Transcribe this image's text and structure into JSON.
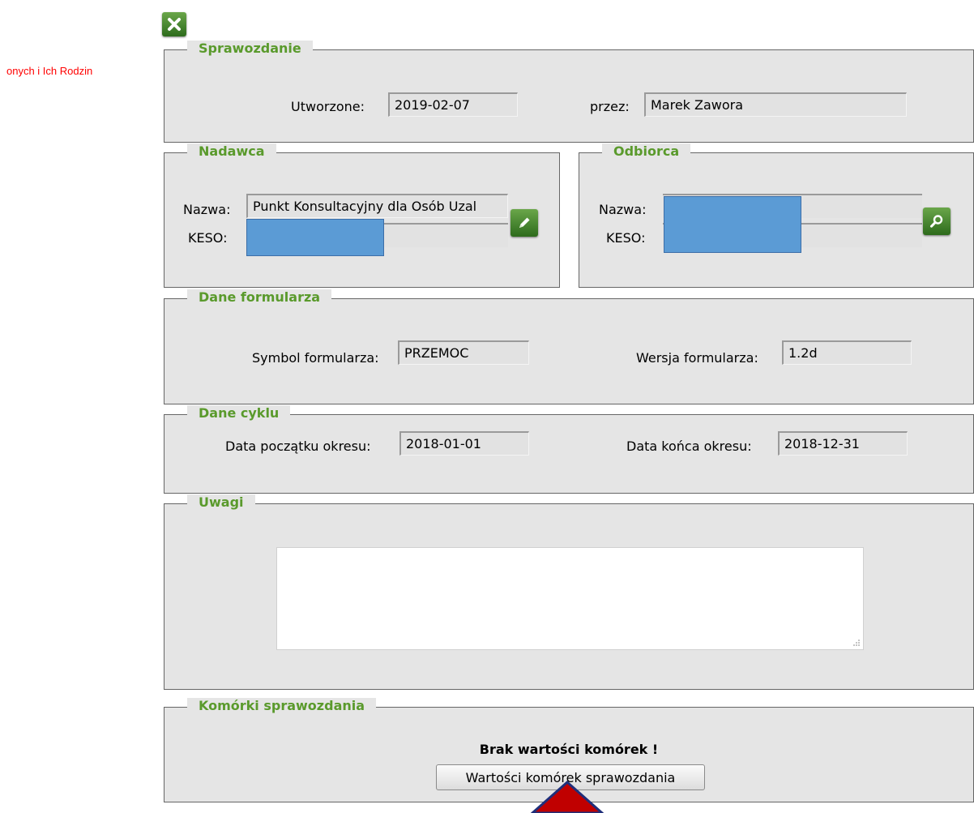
{
  "side_text": "onych i Ich Rodzin",
  "icons": {
    "close": "close-x-icon",
    "edit": "pencil-icon",
    "search": "magnifier-icon"
  },
  "colors": {
    "legend": "#5a9a2c",
    "button_green": "#3f8a2a",
    "redaction": "#5b9bd5",
    "side_text": "#ff0000",
    "arrow": "#c00000"
  },
  "sprawozdanie": {
    "legend": "Sprawozdanie",
    "created_label": "Utworzone:",
    "created_value": "2019-02-07",
    "by_label": "przez:",
    "by_value": "Marek Zawora"
  },
  "nadawca": {
    "legend": "Nadawca",
    "name_label": "Nazwa:",
    "name_value": "Punkt Konsultacyjny dla Osób Uzal",
    "keso_label": "KESO:"
  },
  "odbiorca": {
    "legend": "Odbiorca",
    "name_label": "Nazwa:",
    "keso_label": "KESO:"
  },
  "dane_formularza": {
    "legend": "Dane formularza",
    "symbol_label": "Symbol formularza:",
    "symbol_value": "PRZEMOC",
    "version_label": "Wersja formularza:",
    "version_value": "1.2d"
  },
  "dane_cyklu": {
    "legend": "Dane cyklu",
    "start_label": "Data początku okresu:",
    "start_value": "2018-01-01",
    "end_label": "Data końca okresu:",
    "end_value": "2018-12-31"
  },
  "uwagi": {
    "legend": "Uwagi",
    "value": ""
  },
  "komorki": {
    "legend": "Komórki sprawozdania",
    "message": "Brak wartości komórek !",
    "button_label": "Wartości komórek sprawozdania"
  }
}
